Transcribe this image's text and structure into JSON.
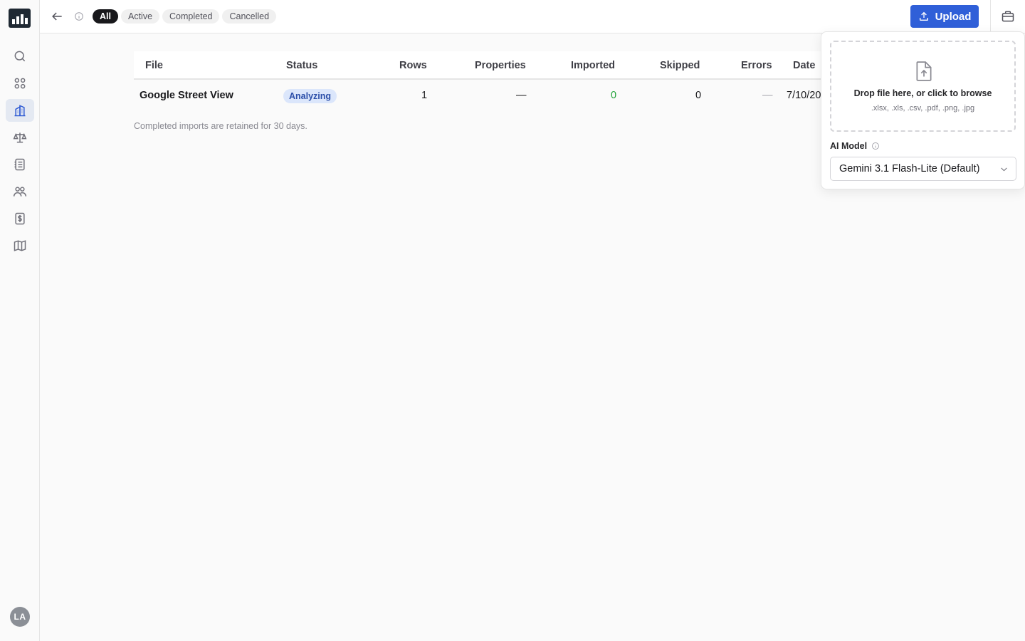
{
  "sidebar": {
    "avatar_initials": "LA",
    "items": [
      {
        "icon": "search-icon"
      },
      {
        "icon": "grid-icon"
      },
      {
        "icon": "buildings-icon",
        "active": true
      },
      {
        "icon": "scale-icon"
      },
      {
        "icon": "ledger-icon"
      },
      {
        "icon": "users-icon"
      },
      {
        "icon": "dollar-file-icon"
      },
      {
        "icon": "map-icon"
      }
    ]
  },
  "topbar": {
    "tabs": [
      {
        "label": "All",
        "active": true
      },
      {
        "label": "Active"
      },
      {
        "label": "Completed"
      },
      {
        "label": "Cancelled"
      }
    ],
    "upload_label": "Upload"
  },
  "table": {
    "columns": [
      "File",
      "Status",
      "Rows",
      "Properties",
      "Imported",
      "Skipped",
      "Errors",
      "Date"
    ],
    "rows": [
      {
        "file": "Google Street View",
        "status": "Analyzing",
        "rows": "1",
        "properties": "—",
        "imported": "0",
        "skipped": "0",
        "errors": "—",
        "date": "7/10/20"
      }
    ],
    "footnote": "Completed imports are retained for 30 days."
  },
  "upload_popover": {
    "drop_title": "Drop file here, or click to browse",
    "drop_formats": ".xlsx, .xls, .csv, .pdf, .png, .jpg",
    "model_label": "AI Model",
    "model_value": "Gemini 3.1 Flash-Lite (Default)"
  },
  "colors": {
    "accent": "#2f5fd8",
    "badge_bg": "#dbe6fb",
    "success": "#22a33a"
  }
}
